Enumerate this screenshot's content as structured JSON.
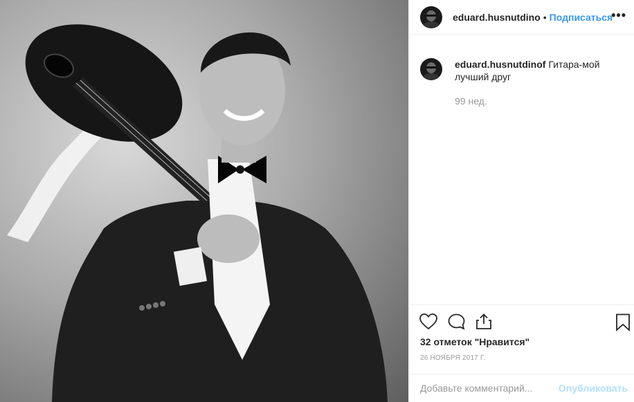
{
  "post": {
    "image_alt": "Мужчина в смокинге с гитарой на плече",
    "author_username": "eduard.husnutdino",
    "separator": "•",
    "follow_label": "Подписаться",
    "more_label": "•••",
    "caption": {
      "username": "eduard.husnutdinof",
      "text": "Гитара-мой лучший друг"
    },
    "time_ago": "99 нед.",
    "likes_text": "32 отметок \"Нравится\"",
    "date": "26 ноября 2017 г.",
    "comment": {
      "placeholder": "Добавьте комментарий...",
      "value": "",
      "publish_label": "Опубликовать"
    }
  },
  "icons": {
    "like": "heart-icon",
    "comment": "comment-icon",
    "share": "share-icon",
    "save": "bookmark-icon"
  }
}
